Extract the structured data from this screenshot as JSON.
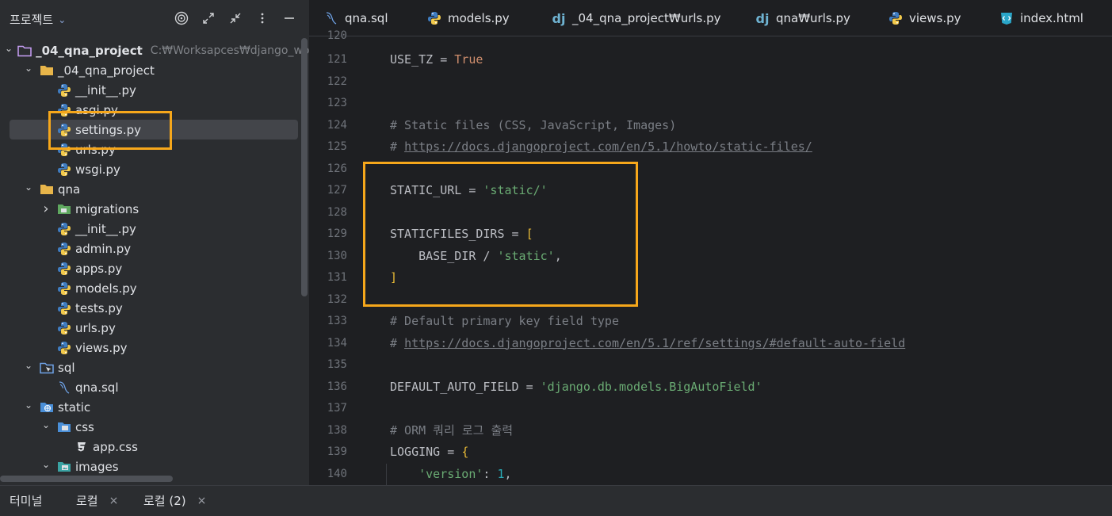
{
  "project_panel": {
    "title": "프로젝트",
    "dropdown_icon": "chevron-down-icon",
    "actions": [
      "target-icon",
      "expand-icon",
      "collapse-icon",
      "more-icon",
      "minimize-icon"
    ],
    "tree": [
      {
        "label": "_04_qna_project",
        "hint": "C:₩Worksapces₩django_wor",
        "icon": "folder-icon",
        "depth": 0,
        "expanded": true,
        "bold": true
      },
      {
        "label": "_04_qna_project",
        "icon": "folder-icon",
        "depth": 1,
        "expanded": true
      },
      {
        "label": "__init__.py",
        "icon": "python-icon",
        "depth": 2
      },
      {
        "label": "asgi.py",
        "icon": "python-icon",
        "depth": 2
      },
      {
        "label": "settings.py",
        "icon": "python-icon",
        "depth": 2,
        "selected": true
      },
      {
        "label": "urls.py",
        "icon": "python-icon",
        "depth": 2
      },
      {
        "label": "wsgi.py",
        "icon": "python-icon",
        "depth": 2
      },
      {
        "label": "qna",
        "icon": "folder-icon",
        "depth": 1,
        "expanded": true
      },
      {
        "label": "migrations",
        "icon": "migrations-folder-icon",
        "depth": 2,
        "expanded": false
      },
      {
        "label": "__init__.py",
        "icon": "python-icon",
        "depth": 2
      },
      {
        "label": "admin.py",
        "icon": "python-icon",
        "depth": 2
      },
      {
        "label": "apps.py",
        "icon": "python-icon",
        "depth": 2
      },
      {
        "label": "models.py",
        "icon": "python-icon",
        "depth": 2
      },
      {
        "label": "tests.py",
        "icon": "python-icon",
        "depth": 2
      },
      {
        "label": "urls.py",
        "icon": "python-icon",
        "depth": 2
      },
      {
        "label": "views.py",
        "icon": "python-icon",
        "depth": 2
      },
      {
        "label": "sql",
        "icon": "sql-folder-icon",
        "depth": 1,
        "expanded": true
      },
      {
        "label": "qna.sql",
        "icon": "sql-file-icon",
        "depth": 2
      },
      {
        "label": "static",
        "icon": "web-folder-icon",
        "depth": 1,
        "expanded": true
      },
      {
        "label": "css",
        "icon": "css-folder-icon",
        "depth": 2,
        "expanded": true
      },
      {
        "label": "app.css",
        "icon": "css-file-icon",
        "depth": 3
      },
      {
        "label": "images",
        "icon": "images-folder-icon",
        "depth": 2,
        "expanded": true
      }
    ]
  },
  "editor": {
    "tabs": [
      {
        "label": "qna.sql",
        "icon": "sql-file-icon"
      },
      {
        "label": "models.py",
        "icon": "python-icon"
      },
      {
        "label": "_04_qna_project₩urls.py",
        "icon": "django-icon"
      },
      {
        "label": "qna₩urls.py",
        "icon": "django-icon"
      },
      {
        "label": "views.py",
        "icon": "python-icon"
      },
      {
        "label": "index.html",
        "icon": "html-icon"
      }
    ],
    "first_line_partial": "120",
    "lines": [
      {
        "n": "121",
        "tokens": [
          [
            "USE_TZ = ",
            "plain"
          ],
          [
            "True",
            "kw"
          ]
        ]
      },
      {
        "n": "122",
        "tokens": []
      },
      {
        "n": "123",
        "tokens": []
      },
      {
        "n": "124",
        "tokens": [
          [
            "# Static files (CSS, JavaScript, Images)",
            "com"
          ]
        ]
      },
      {
        "n": "125",
        "tokens": [
          [
            "# ",
            "com"
          ],
          [
            "https://docs.djangoproject.com/en/5.1/howto/static-files/",
            "link"
          ]
        ]
      },
      {
        "n": "126",
        "tokens": []
      },
      {
        "n": "127",
        "tokens": [
          [
            "STATIC_URL = ",
            "plain"
          ],
          [
            "'static/'",
            "str"
          ]
        ]
      },
      {
        "n": "128",
        "tokens": []
      },
      {
        "n": "129",
        "tokens": [
          [
            "STATICFILES_DIRS = ",
            "plain"
          ],
          [
            "[",
            "br"
          ]
        ]
      },
      {
        "n": "130",
        "tokens": [
          [
            "    BASE_DIR / ",
            "plain"
          ],
          [
            "'static'",
            "str"
          ],
          [
            ",",
            "plain"
          ]
        ]
      },
      {
        "n": "131",
        "tokens": [
          [
            "]",
            "br"
          ]
        ]
      },
      {
        "n": "132",
        "tokens": []
      },
      {
        "n": "133",
        "tokens": [
          [
            "# Default primary key field type",
            "com"
          ]
        ]
      },
      {
        "n": "134",
        "tokens": [
          [
            "# ",
            "com"
          ],
          [
            "https://docs.djangoproject.com/en/5.1/ref/settings/#default-auto-field",
            "link"
          ]
        ]
      },
      {
        "n": "135",
        "tokens": []
      },
      {
        "n": "136",
        "tokens": [
          [
            "DEFAULT_AUTO_FIELD = ",
            "plain"
          ],
          [
            "'django.db.models.BigAutoField'",
            "str"
          ]
        ]
      },
      {
        "n": "137",
        "tokens": []
      },
      {
        "n": "138",
        "tokens": [
          [
            "# ORM 쿼리 로그 출력",
            "com"
          ]
        ]
      },
      {
        "n": "139",
        "tokens": [
          [
            "LOGGING = ",
            "plain"
          ],
          [
            "{",
            "br"
          ]
        ]
      },
      {
        "n": "140",
        "tokens": [
          [
            "    ",
            "plain"
          ],
          [
            "'version'",
            "str"
          ],
          [
            ": ",
            "plain"
          ],
          [
            "1",
            "num"
          ],
          [
            ",",
            "plain"
          ]
        ]
      }
    ]
  },
  "terminal": {
    "title": "터미널",
    "tabs": [
      {
        "label": "로컬",
        "close": "×"
      },
      {
        "label": "로컬 (2)",
        "close": "×"
      }
    ]
  },
  "colors": {
    "highlight": "#f6a71b",
    "string": "#6aab73",
    "keyword": "#cf8e6d",
    "comment": "#7a7e85",
    "number": "#2aacb8",
    "bracket": "#e8ba36"
  }
}
